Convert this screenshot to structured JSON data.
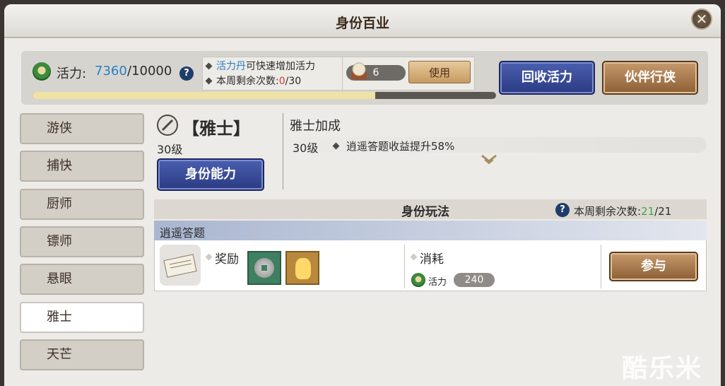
{
  "window": {
    "title": "身份百业",
    "close_glyph": "✕"
  },
  "top": {
    "vigor_label": "活力:",
    "vigor_current": "7360",
    "vigor_max": "/10000",
    "help_glyph": "?",
    "progress": 0.74,
    "tip1_highlight": "活力丹",
    "tip1_text": "可快速增加活力",
    "tip2_text": "本周剩余次数:",
    "tip2_used": "0",
    "tip2_total": "/30",
    "item_count": "6",
    "use_label": "使用",
    "recycle_label": "回收活力",
    "partner_label": "伙伴行侠"
  },
  "sidebar": {
    "items": [
      {
        "label": "游侠"
      },
      {
        "label": "捕快"
      },
      {
        "label": "厨师"
      },
      {
        "label": "镖师"
      },
      {
        "label": "悬眼"
      },
      {
        "label": "雅士"
      },
      {
        "label": "天芒"
      }
    ],
    "active_index": 5
  },
  "identity": {
    "name": "【雅士】",
    "level": "30级",
    "ability_label": "身份能力",
    "bonus_title": "雅士加成",
    "bonus_level": "30级",
    "bonus_text": "逍遥答题收益提升58%"
  },
  "gameplay": {
    "title": "身份玩法",
    "weekly_label": "本周剩余次数:",
    "weekly_remaining": "21",
    "weekly_total": "/21",
    "card": {
      "title": "逍遥答题",
      "reward_label": "奖励",
      "cost_label": "消耗",
      "cost_name": "活力",
      "cost_value": "240",
      "join_label": "参与"
    }
  },
  "watermark": "酷乐米",
  "colors": {
    "accent_blue": "#2a7fc9",
    "accent_green": "#3aa84a",
    "accent_red": "#d23a2a"
  },
  "icons": [
    "close-icon",
    "vigor-icon",
    "help-icon",
    "bead-icon",
    "brush-icon",
    "chevron-down-icon",
    "scroll-icon",
    "coin-icon",
    "gold-icon"
  ]
}
